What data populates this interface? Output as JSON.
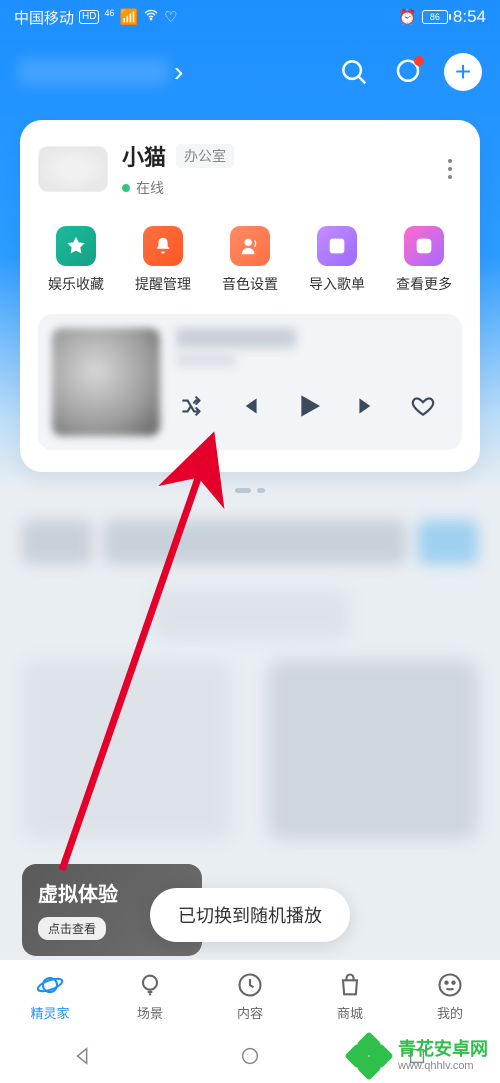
{
  "status": {
    "carrier": "中国移动",
    "hd": "HD",
    "net": "46",
    "battery": "86",
    "time": "8:54"
  },
  "device": {
    "name": "小猫",
    "room": "办公室",
    "status": "在线"
  },
  "quick_actions": [
    {
      "label": "娱乐收藏"
    },
    {
      "label": "提醒管理"
    },
    {
      "label": "音色设置"
    },
    {
      "label": "导入歌单"
    },
    {
      "label": "查看更多"
    }
  ],
  "virtual": {
    "title": "虚拟体验",
    "button": "点击查看"
  },
  "toast": "已切换到随机播放",
  "tabs": [
    {
      "label": "精灵家",
      "active": true
    },
    {
      "label": "场景"
    },
    {
      "label": "内容"
    },
    {
      "label": "商城"
    },
    {
      "label": "我的"
    }
  ],
  "watermark": {
    "name": "青花安卓网",
    "url": "www.qhhlv.com"
  }
}
